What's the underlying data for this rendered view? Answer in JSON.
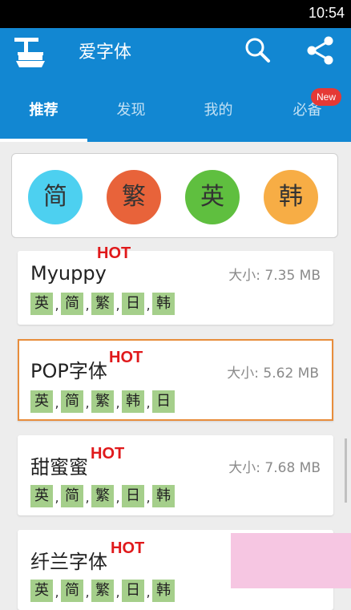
{
  "status_bar": {
    "time": "10:54"
  },
  "app_bar": {
    "title": "爱字体"
  },
  "tabs": [
    {
      "label": "推荐",
      "active": true
    },
    {
      "label": "发现",
      "active": false
    },
    {
      "label": "我的",
      "active": false
    },
    {
      "label": "必备",
      "active": false,
      "badge": "New"
    }
  ],
  "categories": [
    {
      "label": "简",
      "color": "#4dd0f0"
    },
    {
      "label": "繁",
      "color": "#e8633a"
    },
    {
      "label": "英",
      "color": "#5fbf3f"
    },
    {
      "label": "韩",
      "color": "#f7ad45"
    }
  ],
  "fonts": [
    {
      "name": "Myuppy",
      "hot": "HOT",
      "size": "大小: 7.35 MB",
      "langs": [
        "英",
        "简",
        "繁",
        "日",
        "韩"
      ],
      "selected": false
    },
    {
      "name": "POP字体",
      "hot": "HOT",
      "size": "大小: 5.62 MB",
      "langs": [
        "英",
        "简",
        "繁",
        "韩",
        "日"
      ],
      "selected": true
    },
    {
      "name": "甜蜜蜜",
      "hot": "HOT",
      "size": "大小: 7.68 MB",
      "langs": [
        "英",
        "简",
        "繁",
        "日",
        "韩"
      ],
      "selected": false
    },
    {
      "name": "纤兰字体",
      "hot": "HOT",
      "size": "",
      "langs": [
        "英",
        "简",
        "繁",
        "日",
        "韩"
      ],
      "selected": false
    }
  ],
  "colors": {
    "app_bar": "#1287d2",
    "hot": "#e0191b",
    "lang_tag": "#a5cf8b",
    "selected_border": "#e88d3c",
    "badge": "#e53935"
  }
}
